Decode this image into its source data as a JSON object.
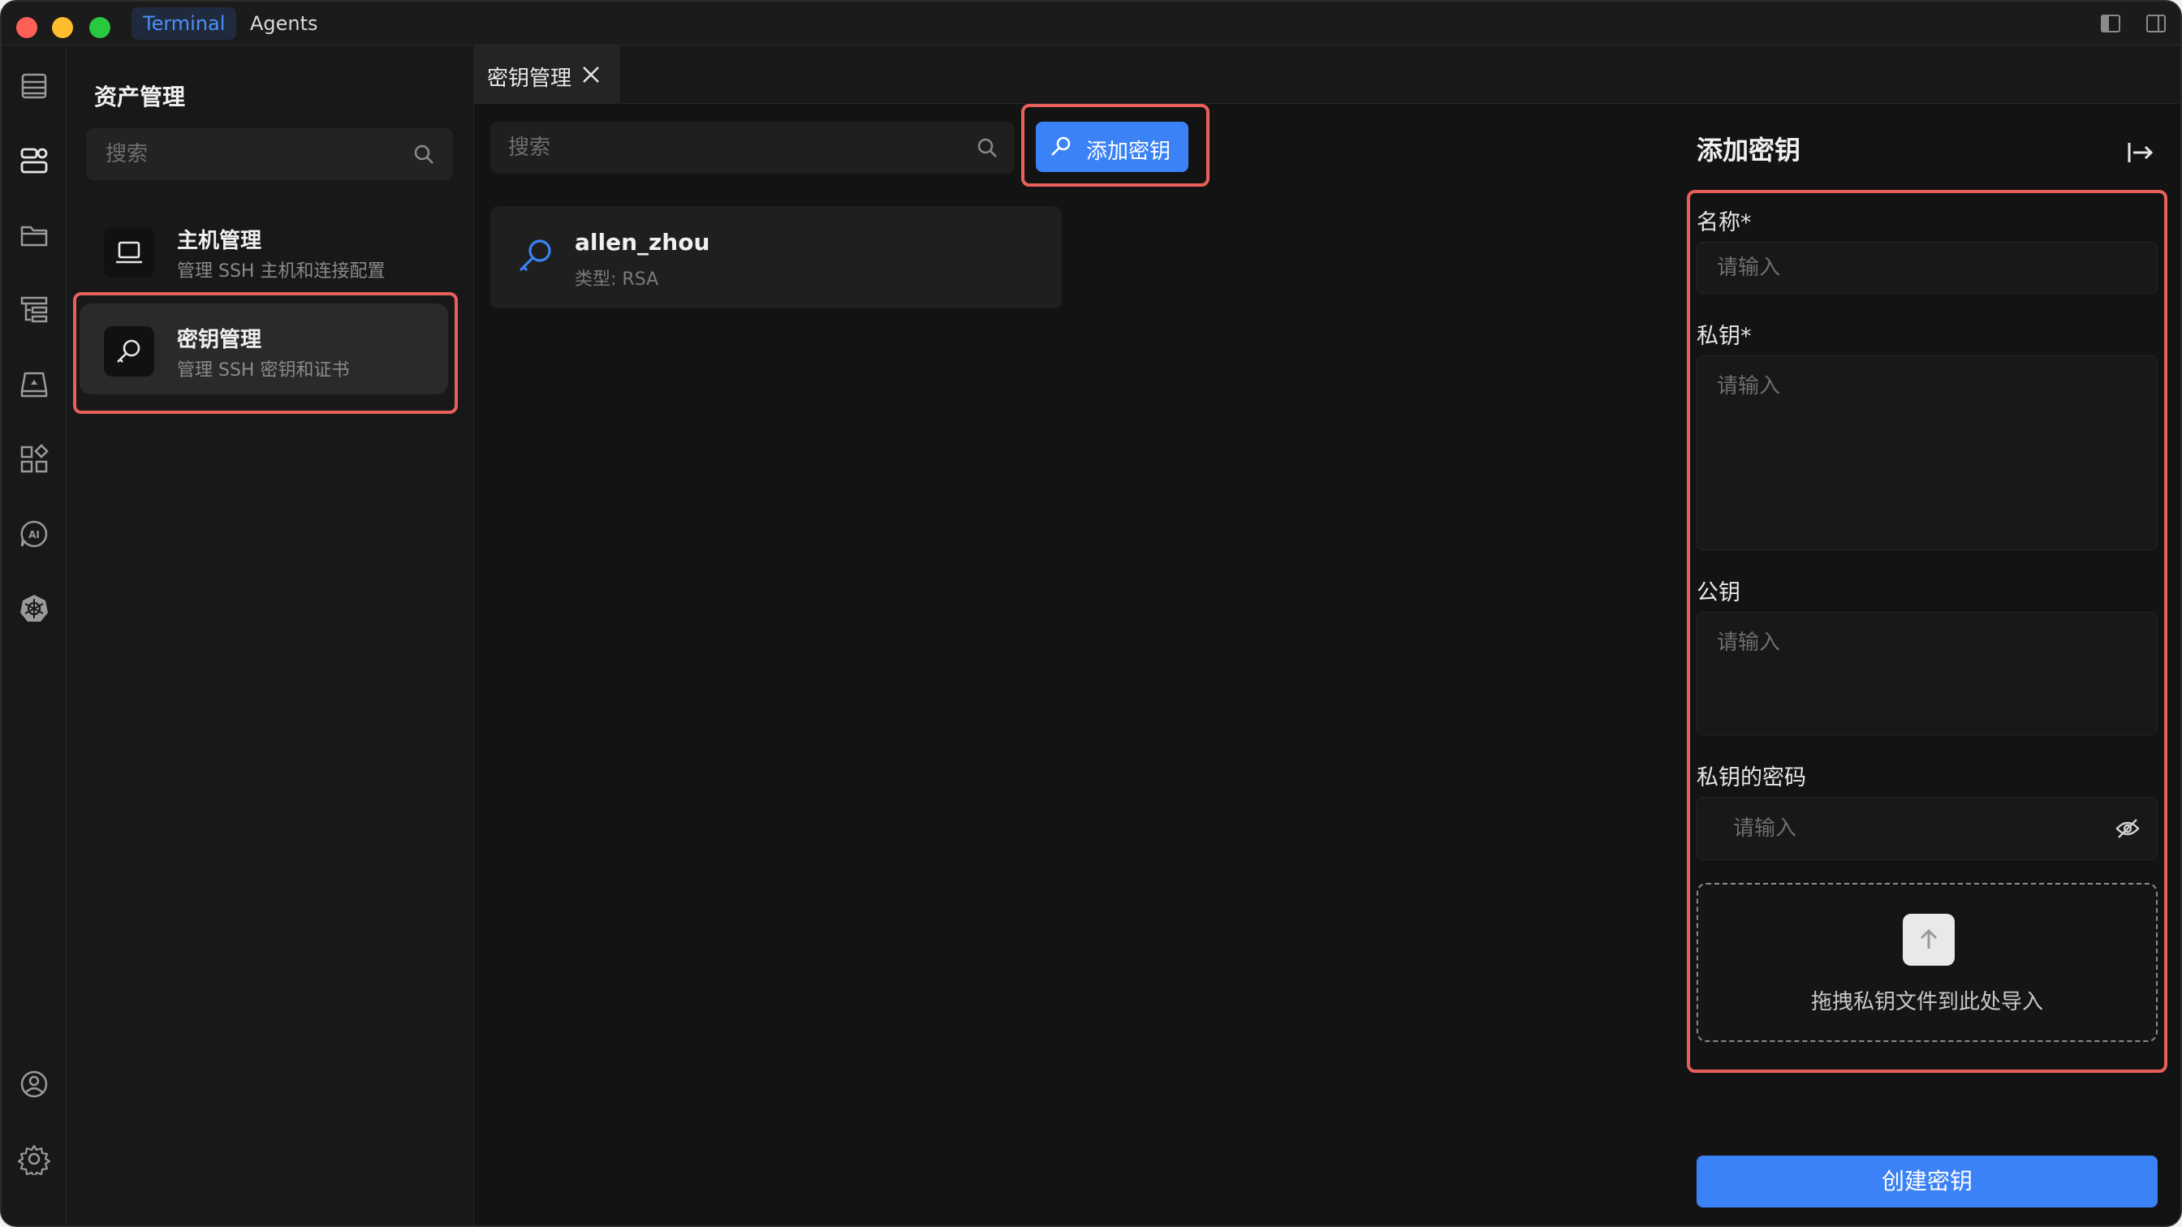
{
  "titlebar": {
    "tabs": [
      {
        "label": "Terminal",
        "active": true
      },
      {
        "label": "Agents",
        "active": false
      }
    ]
  },
  "rail": {
    "icons": [
      "server-list-icon",
      "assets-icon",
      "folder-icon",
      "tree-icon",
      "drive-icon",
      "apps-icon",
      "ai-icon",
      "kubernetes-icon",
      "account-icon",
      "settings-icon"
    ]
  },
  "sidebar": {
    "title": "资产管理",
    "search_placeholder": "搜索",
    "items": [
      {
        "title": "主机管理",
        "desc": "管理 SSH 主机和连接配置",
        "icon": "laptop-icon"
      },
      {
        "title": "密钥管理",
        "desc": "管理 SSH 密钥和证书",
        "icon": "key-icon"
      }
    ]
  },
  "doc_tab": {
    "label": "密钥管理"
  },
  "main": {
    "search_placeholder": "搜索",
    "add_button_label": "添加密钥",
    "keys": [
      {
        "name": "allen_zhou",
        "type": "类型: RSA"
      }
    ]
  },
  "panel": {
    "title": "添加密钥",
    "name_label": "名称*",
    "name_placeholder": "请输入",
    "private_key_label": "私钥*",
    "private_key_placeholder": "请输入",
    "public_key_label": "公钥",
    "public_key_placeholder": "请输入",
    "passphrase_label": "私钥的密码",
    "passphrase_placeholder": "请输入",
    "drop_text": "拖拽私钥文件到此处导入",
    "create_button_label": "创建密钥"
  },
  "colors": {
    "accent": "#3b82f6",
    "highlight": "#e8605a",
    "background": "#131313"
  }
}
